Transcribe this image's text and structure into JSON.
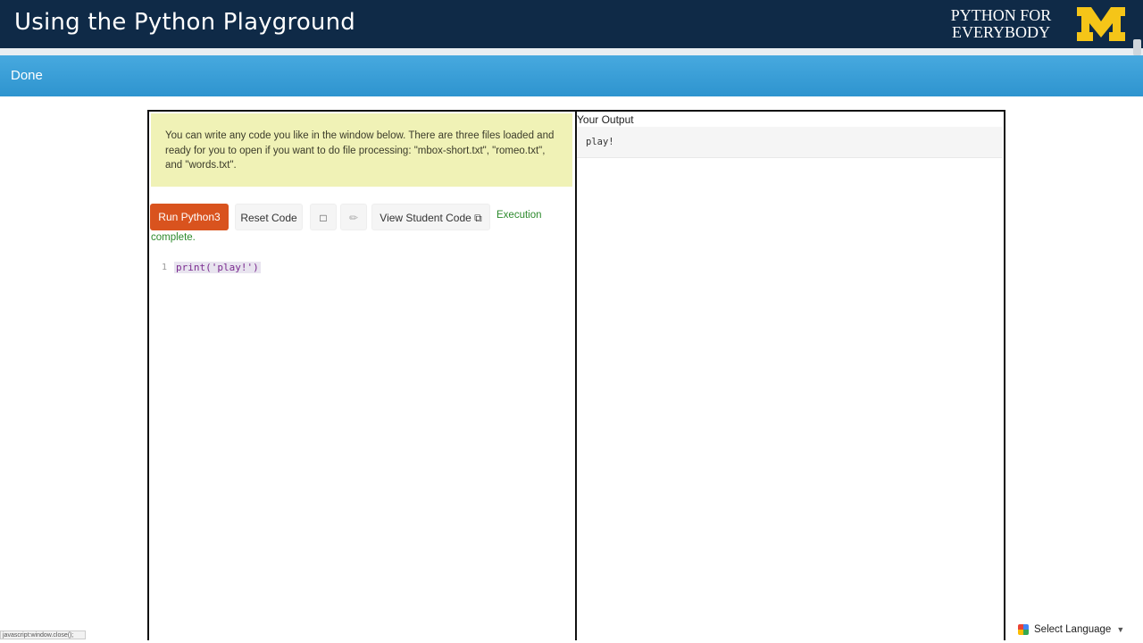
{
  "banner": {
    "title": "Using the Python Playground",
    "brand_line1": "PYTHON FOR",
    "brand_line2": "EVERYBODY",
    "logo_icon": "block-m-logo",
    "logo_color": "#f5c518",
    "background": "#0f2a47"
  },
  "nav": {
    "done_label": "Done",
    "background": "#3aa0d8"
  },
  "notice": {
    "text": "You can write any code you like in the window below. There are three files loaded and ready for you to open if you want to do file processing: \"mbox-short.txt\", \"romeo.txt\", and \"words.txt\"."
  },
  "toolbar": {
    "run_label": "Run Python3",
    "reset_label": "Reset Code",
    "square_icon": "□",
    "pencil_icon": "✏",
    "view_label": "View Student Code",
    "external_icon": "⧉",
    "status_line1": "Execution",
    "status_line2": "complete."
  },
  "editor": {
    "line_number": "1",
    "code": "print('play!')"
  },
  "output": {
    "heading": "Your Output",
    "text": "play!"
  },
  "statusbar": {
    "text": "javascript:window.close();"
  },
  "language": {
    "label": "Select Language",
    "caret": "▼"
  },
  "colors": {
    "run_button": "#d9531e",
    "notice_bg": "#f0f2b6",
    "status_green": "#2d8a2d"
  }
}
